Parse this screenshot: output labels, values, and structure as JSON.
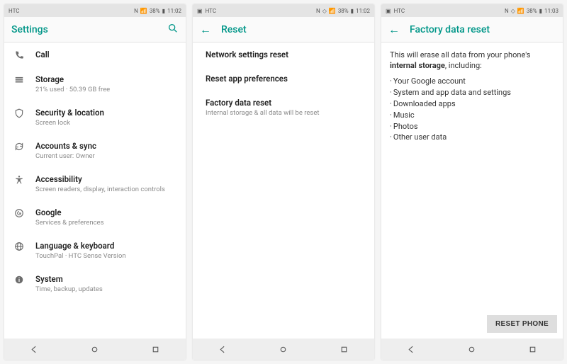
{
  "status": {
    "carrier": "HTC",
    "battery_text": "38%",
    "time_left": "11:02",
    "time_right": "11:03"
  },
  "screen1": {
    "title": "Settings",
    "items": [
      {
        "icon": "phone-icon",
        "primary": "Call",
        "secondary": ""
      },
      {
        "icon": "storage-icon",
        "primary": "Storage",
        "secondary": "21% used · 50.39 GB free"
      },
      {
        "icon": "shield-icon",
        "primary": "Security & location",
        "secondary": "Screen lock"
      },
      {
        "icon": "sync-icon",
        "primary": "Accounts & sync",
        "secondary": "Current user: Owner"
      },
      {
        "icon": "accessibility-icon",
        "primary": "Accessibility",
        "secondary": "Screen readers, display, interaction controls"
      },
      {
        "icon": "google-icon",
        "primary": "Google",
        "secondary": "Services & preferences"
      },
      {
        "icon": "globe-icon",
        "primary": "Language & keyboard",
        "secondary": "TouchPal · HTC Sense Version"
      },
      {
        "icon": "info-icon",
        "primary": "System",
        "secondary": "Time, backup, updates"
      }
    ]
  },
  "screen2": {
    "title": "Reset",
    "items": [
      {
        "primary": "Network settings reset",
        "secondary": ""
      },
      {
        "primary": "Reset app preferences",
        "secondary": ""
      },
      {
        "primary": "Factory data reset",
        "secondary": "Internal storage & all data will be reset"
      }
    ]
  },
  "screen3": {
    "title": "Factory data reset",
    "intro_a": "This will erase all data from your phone's ",
    "intro_b": "internal storage",
    "intro_c": ", including:",
    "bullets": [
      "Your Google account",
      "System and app data and settings",
      "Downloaded apps",
      "Music",
      "Photos",
      "Other user data"
    ],
    "button": "RESET PHONE"
  }
}
